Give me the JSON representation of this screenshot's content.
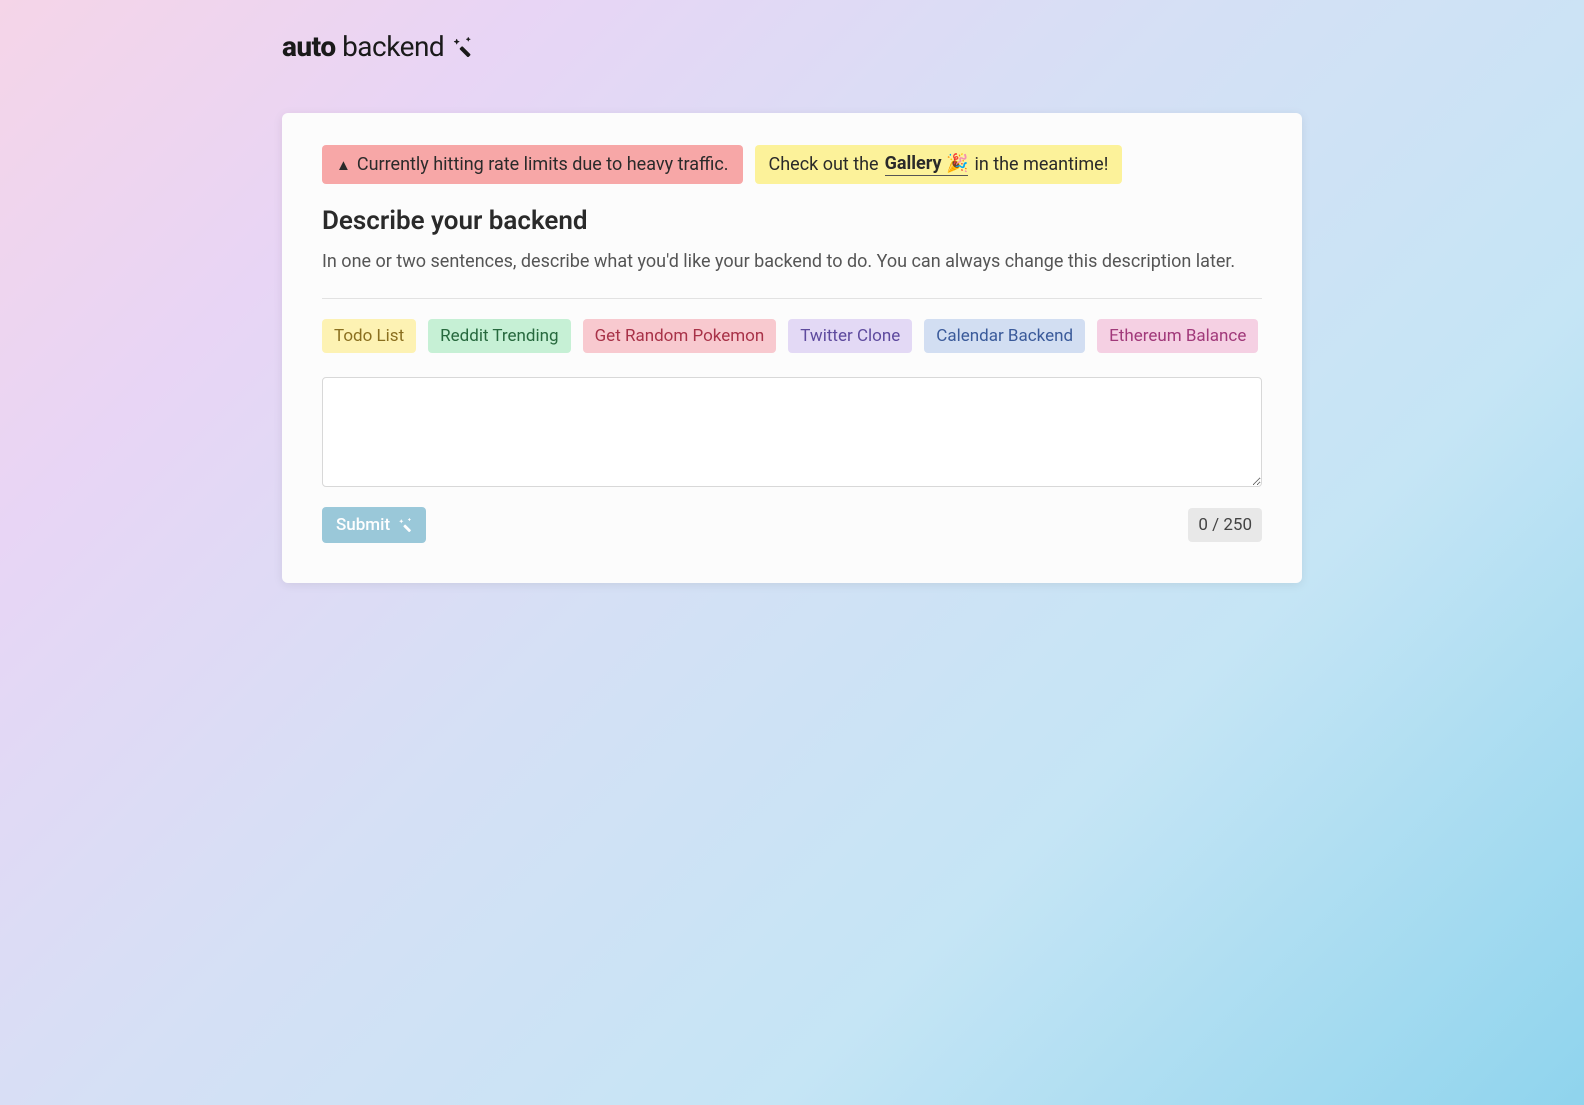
{
  "logo": {
    "bold": "auto",
    "light": " backend"
  },
  "alerts": {
    "warning_icon": "▲",
    "warning_text": "Currently hitting rate limits due to heavy traffic.",
    "info_prefix": "Check out the ",
    "info_link": "Gallery 🎉",
    "info_suffix": " in the meantime!"
  },
  "main": {
    "heading": "Describe your backend",
    "subheading": "In one or two sentences, describe what you'd like your backend to do. You can always change this description later."
  },
  "examples": [
    {
      "label": "Todo List",
      "color": "yellow"
    },
    {
      "label": "Reddit Trending",
      "color": "green"
    },
    {
      "label": "Get Random Pokemon",
      "color": "red"
    },
    {
      "label": "Twitter Clone",
      "color": "purple"
    },
    {
      "label": "Calendar Backend",
      "color": "blue"
    },
    {
      "label": "Ethereum Balance",
      "color": "pink"
    }
  ],
  "form": {
    "input_value": "",
    "submit_label": "Submit",
    "char_count": "0 / 250"
  }
}
